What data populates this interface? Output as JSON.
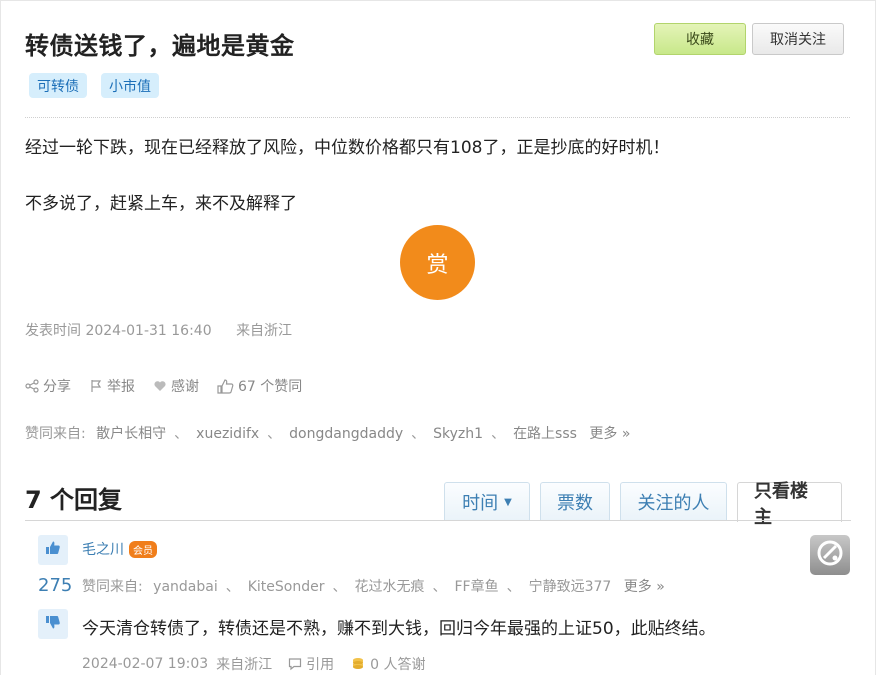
{
  "post": {
    "title": "转债送钱了，遍地是黄金",
    "fav_label": "收藏",
    "unfollow_label": "取消关注",
    "tags": [
      "可转债",
      "小市值"
    ],
    "paragraph1": "经过一轮下跌，现在已经释放了风险，中位数价格都只有108了，正是抄底的好时机！",
    "paragraph2": "不多说了，赶紧上车，来不及解释了",
    "reward_label": "赏",
    "publish_time": "发表时间 2024-01-31 16:40",
    "location": "来自浙江",
    "actions": {
      "share": "分享",
      "report": "举报",
      "thanks": "感谢",
      "votes": "67 个赞同"
    },
    "likers_prefix": "赞同来自:",
    "likers": [
      "散户长相守",
      "xuezidifx",
      "dongdangdaddy",
      "Skyzh1",
      "在路上sss"
    ],
    "likers_more": "更多 »"
  },
  "replies_section": {
    "count_label": "7 个回复",
    "tabs": [
      "时间",
      "票数",
      "关注的人",
      "只看楼主"
    ]
  },
  "reply": {
    "author": "毛之川",
    "badge": "会员",
    "vote_count": "275",
    "likers_prefix": "赞同来自:",
    "likers": [
      "yandabai",
      "KiteSonder",
      "花过水无痕",
      "FF章鱼",
      "宁静致远377"
    ],
    "likers_more": "更多 »",
    "text": "今天清仓转债了，转债还是不熟，赚不到大钱，回归今年最强的上证50，此贴终结。",
    "time": "2024-02-07 19:03",
    "location": "来自浙江",
    "quote_label": "引用",
    "thanks_label": "0 人答谢"
  },
  "colors": {
    "accent_blue": "#3d7fb3",
    "reward_orange": "#f28b1b",
    "fav_green": "#c8e88a"
  }
}
